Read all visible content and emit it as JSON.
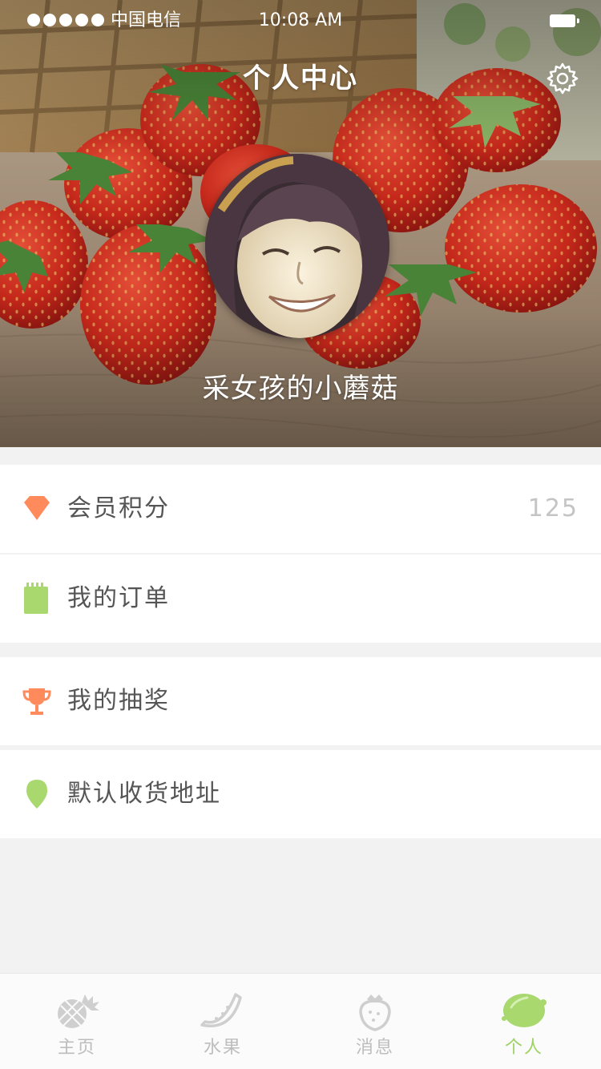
{
  "status_bar": {
    "carrier": "中国电信",
    "time": "10:08 AM"
  },
  "header": {
    "title": "个人中心",
    "settings_icon": "gear-icon"
  },
  "profile": {
    "username": "采女孩的小蘑菇",
    "avatar": "avatar-photo"
  },
  "menu": {
    "points": {
      "label": "会员积分",
      "value": "125",
      "icon": "diamond-icon",
      "color": "#ff8a5b"
    },
    "orders": {
      "label": "我的订单",
      "icon": "notepad-icon",
      "color": "#a8d86e"
    },
    "lottery": {
      "label": "我的抽奖",
      "icon": "trophy-icon",
      "color": "#ff8a5b"
    },
    "address": {
      "label": "默认收货地址",
      "icon": "location-pin-icon",
      "color": "#a8d86e"
    }
  },
  "tabbar": {
    "home": {
      "label": "主页",
      "icon": "pineapple-icon"
    },
    "fruit": {
      "label": "水果",
      "icon": "watermelon-icon"
    },
    "messages": {
      "label": "消息",
      "icon": "strawberry-icon"
    },
    "profile": {
      "label": "个人",
      "icon": "lime-icon",
      "active": true
    }
  },
  "colors": {
    "accent_green": "#9fd267",
    "accent_orange": "#ff8a5b",
    "inactive_gray": "#bdbdbd",
    "background": "#f2f2f2"
  }
}
